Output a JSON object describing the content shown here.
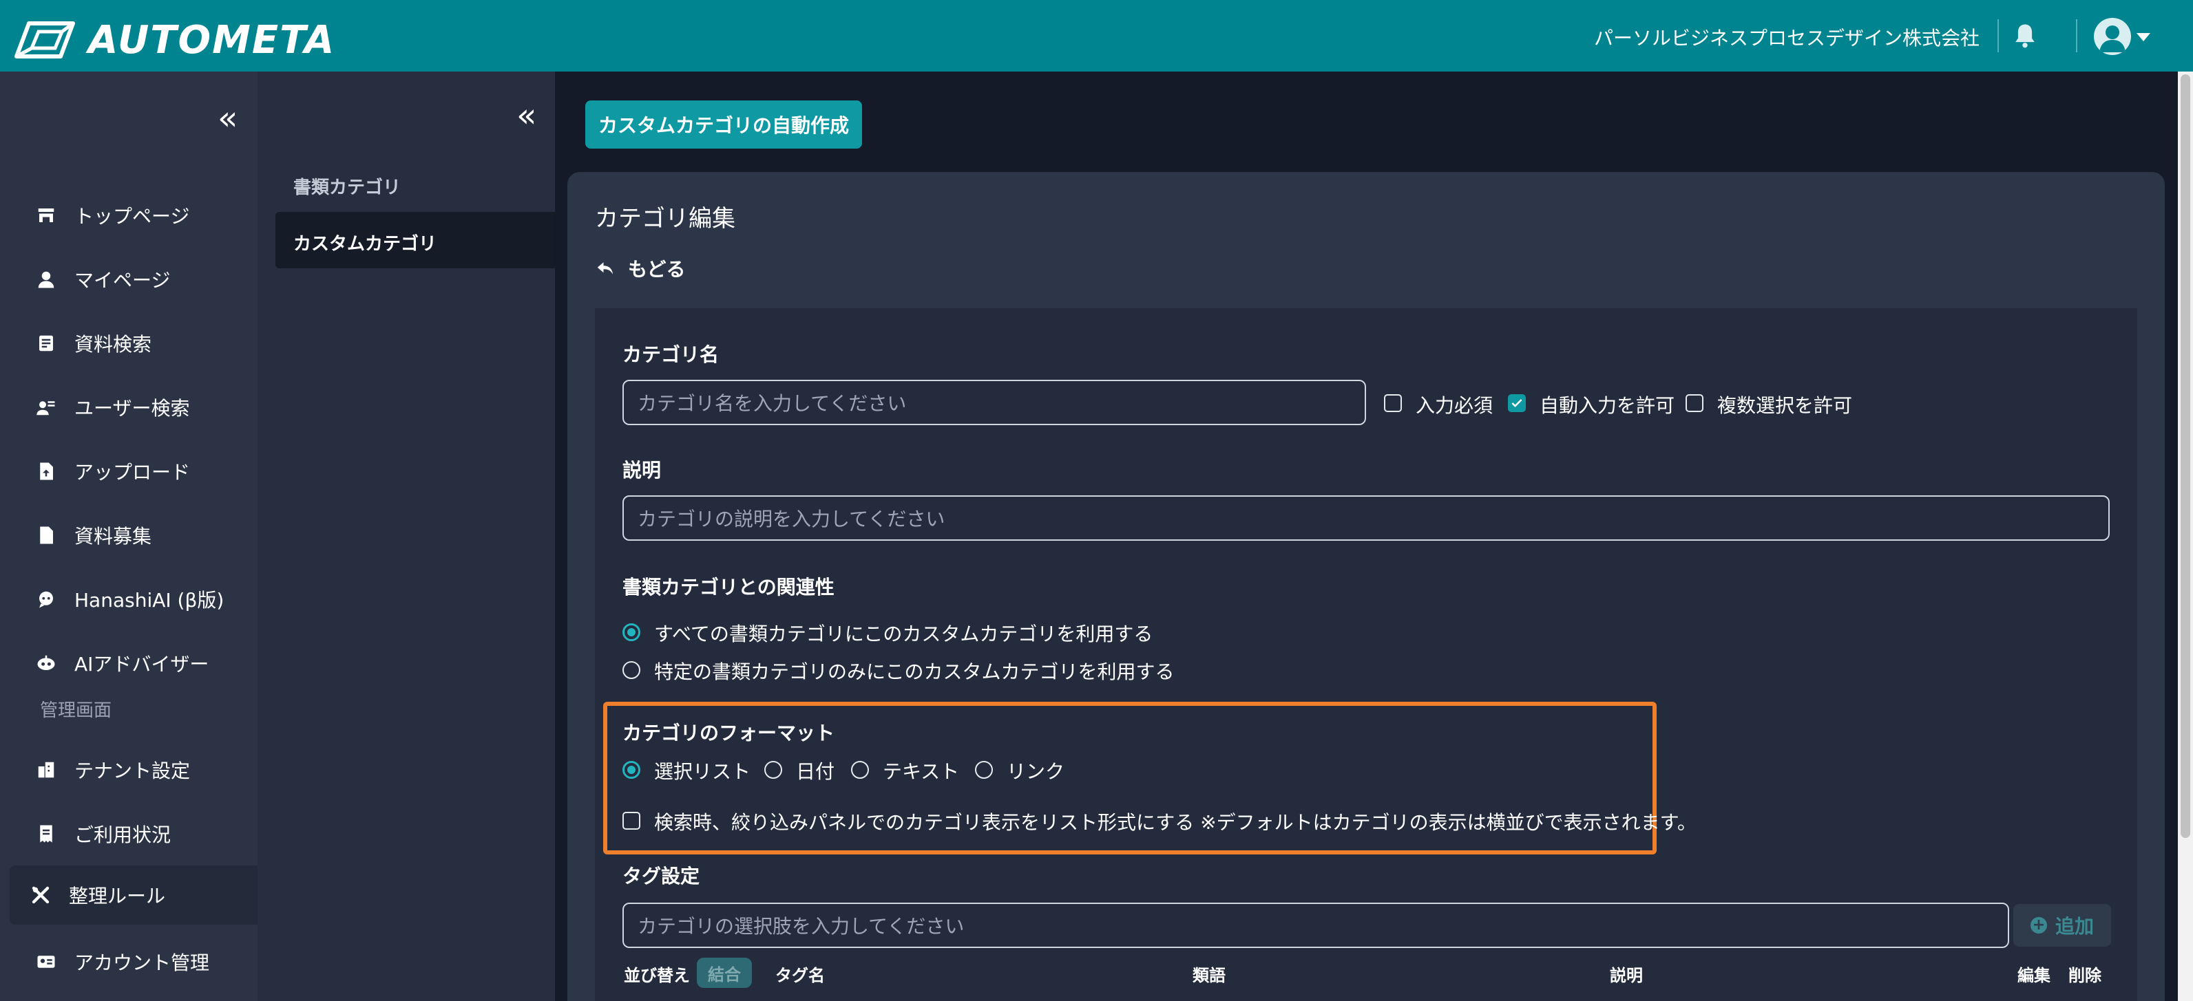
{
  "header": {
    "logo_text": "AUTOMETA",
    "company": "パーソルビジネスプロセスデザイン株式会社",
    "bell_icon": "bell-icon",
    "avatar_icon": "user-avatar-icon",
    "color": "#00848f"
  },
  "sidebar": {
    "items": [
      {
        "label": "トップページ",
        "icon": "store-icon"
      },
      {
        "label": "マイページ",
        "icon": "person-icon"
      },
      {
        "label": "資料検索",
        "icon": "document-search-icon"
      },
      {
        "label": "ユーザー検索",
        "icon": "user-search-icon"
      },
      {
        "label": "アップロード",
        "icon": "file-upload-icon"
      },
      {
        "label": "資料募集",
        "icon": "document-icon"
      },
      {
        "label": "HanashiAI (β版)",
        "icon": "chat-ai-icon"
      },
      {
        "label": "AIアドバイザー",
        "icon": "robot-icon"
      }
    ],
    "section_label": "管理画面",
    "admin_items": [
      {
        "label": "テナント設定",
        "icon": "building-icon"
      },
      {
        "label": "ご利用状況",
        "icon": "receipt-icon"
      },
      {
        "label": "整理ルール",
        "icon": "tools-icon",
        "active": true
      },
      {
        "label": "アカウント管理",
        "icon": "id-card-icon"
      }
    ]
  },
  "subsidebar": {
    "items": [
      "書類カテゴリ",
      "カスタムカテゴリ"
    ],
    "active": "カスタムカテゴリ"
  },
  "main": {
    "auto_create_button": "カスタムカテゴリの自動作成",
    "panel_title": "カテゴリ編集",
    "back_label": "もどる",
    "category_name": {
      "label": "カテゴリ名",
      "placeholder": "カテゴリ名を入力してください",
      "required_label": "入力必須",
      "required_checked": false,
      "auto_input_label": "自動入力を許可",
      "auto_input_checked": true,
      "multi_select_label": "複数選択を許可",
      "multi_select_checked": false
    },
    "description": {
      "label": "説明",
      "placeholder": "カテゴリの説明を入力してください"
    },
    "relation": {
      "label": "書類カテゴリとの関連性",
      "options": [
        "すべての書類カテゴリにこのカスタムカテゴリを利用する",
        "特定の書類カテゴリのみにこのカスタムカテゴリを利用する"
      ],
      "selected": 0
    },
    "format": {
      "label": "カテゴリのフォーマット",
      "options": [
        "選択リスト",
        "日付",
        "テキスト",
        "リンク"
      ],
      "selected": 0,
      "list_display_label": "検索時、絞り込みパネルでのカテゴリ表示をリスト形式にする ※デフォルトはカテゴリの表示は横並びで表示されます。",
      "list_display_checked": false,
      "highlight_color": "#ee7f2d"
    },
    "tags": {
      "label": "タグ設定",
      "placeholder": "カテゴリの選択肢を入力してください",
      "add_label": "追加",
      "columns": {
        "sort": "並び替え",
        "merge": "結合",
        "tag_name": "タグ名",
        "synonym": "類語",
        "description": "説明",
        "edit": "編集",
        "delete": "削除"
      }
    }
  }
}
